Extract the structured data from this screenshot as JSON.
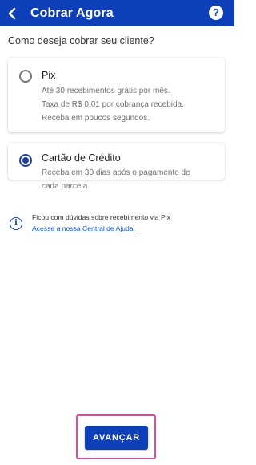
{
  "header": {
    "title": "Cobrar Agora",
    "help_label": "?"
  },
  "question": "Como deseja cobrar seu cliente?",
  "options": [
    {
      "title": "Pix",
      "selected": false,
      "description": [
        "Até 30 recebimentos grátis por mês.",
        "Taxa de R$ 0,01 por cobrança recebida.",
        "Receba em poucos segundos."
      ]
    },
    {
      "title": "Cartão de Crédito",
      "selected": true,
      "description": [
        "Receba em 30 dias após o pagamento de",
        "cada parcela."
      ]
    }
  ],
  "info": {
    "text": "Ficou com dúvidas sobre recebimento via Pix",
    "link": "Acesse a nossa Central de Ajuda."
  },
  "footer": {
    "next_label": "AVANÇAR"
  },
  "colors": {
    "primary": "#0d3fb8",
    "radio_selected": "#1f3e9e",
    "link": "#1a56c4",
    "highlight": "#e0479e"
  }
}
